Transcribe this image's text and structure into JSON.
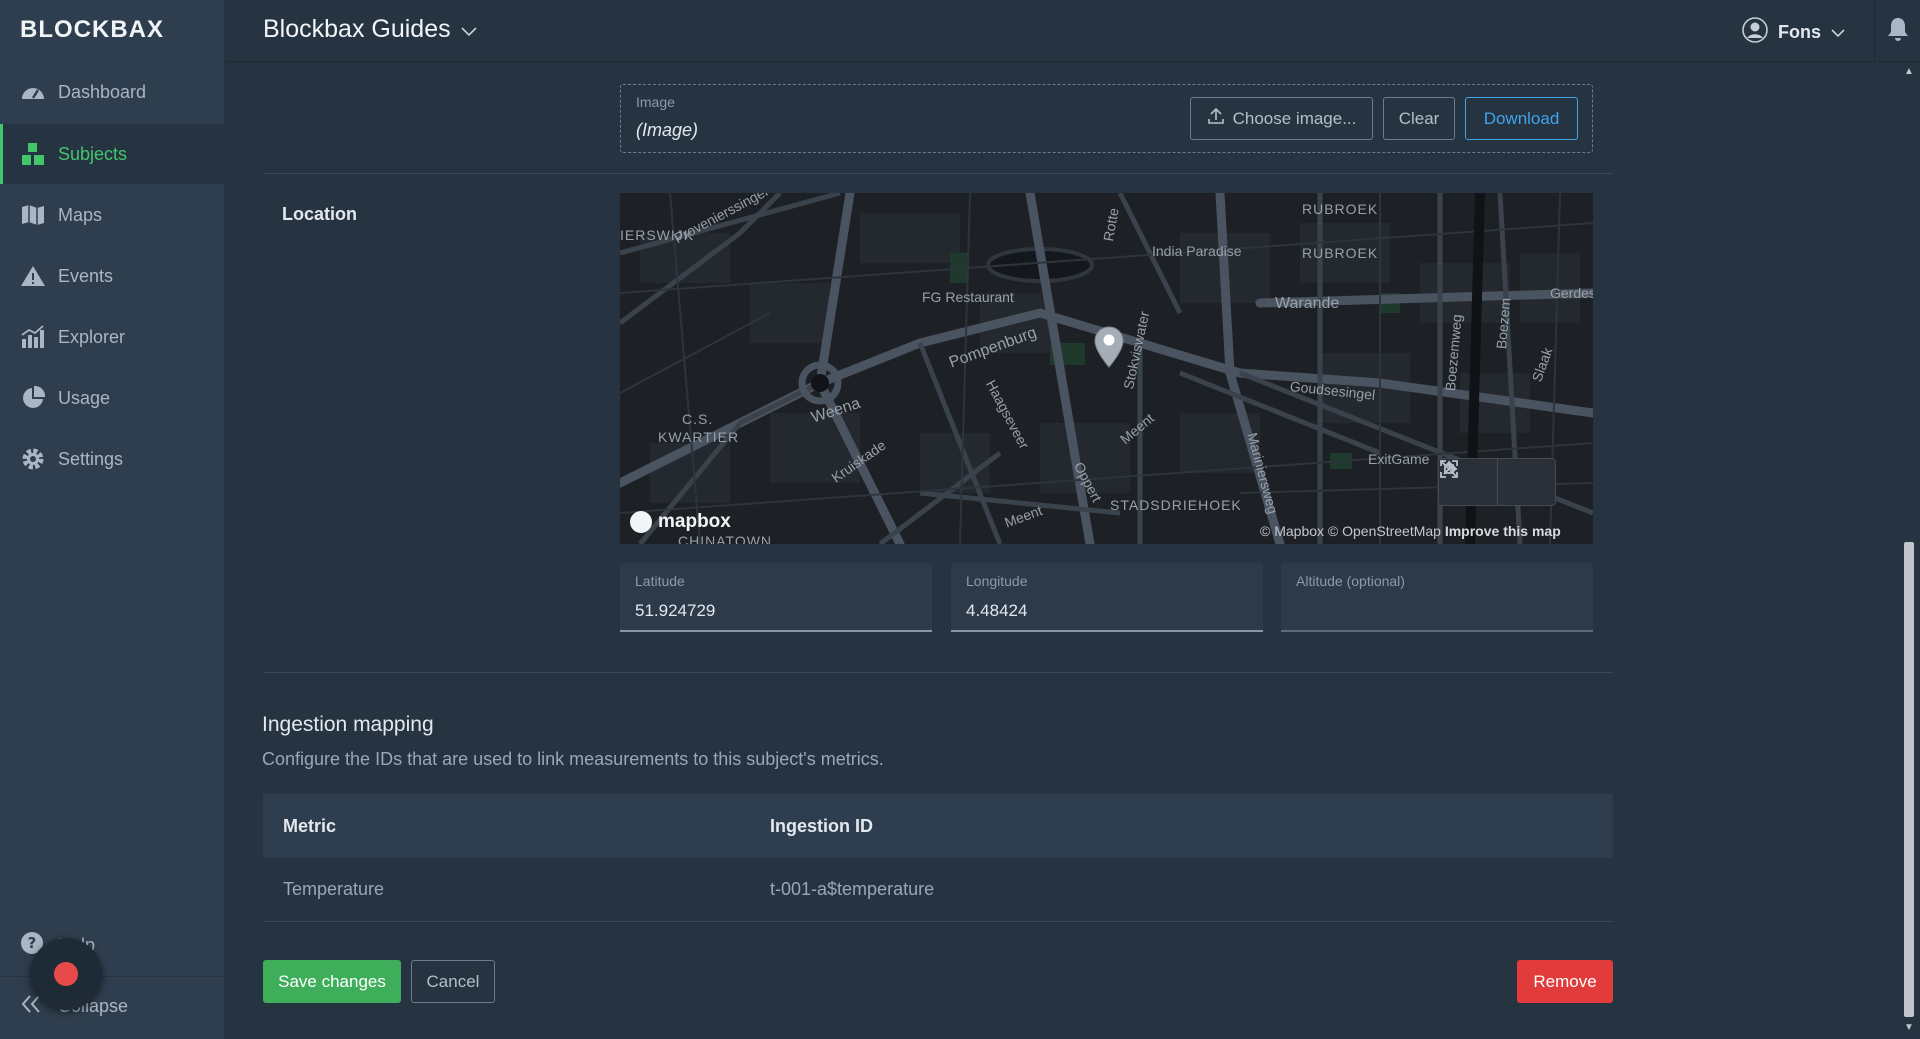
{
  "sidebar": {
    "logo": "BLOCKBAX",
    "items": [
      {
        "label": "Dashboard",
        "icon": "gauge-icon"
      },
      {
        "label": "Subjects",
        "icon": "blocks-icon"
      },
      {
        "label": "Maps",
        "icon": "map-icon"
      },
      {
        "label": "Events",
        "icon": "warning-icon"
      },
      {
        "label": "Explorer",
        "icon": "bar-chart-icon"
      },
      {
        "label": "Usage",
        "icon": "pie-chart-icon"
      },
      {
        "label": "Settings",
        "icon": "gear-icon"
      }
    ],
    "active_item": "Subjects",
    "help_label": "Help",
    "collapse_label": "Collapse"
  },
  "header": {
    "title": "Blockbax Guides",
    "user_name": "Fons"
  },
  "image_field": {
    "label": "Image",
    "value": "(Image)",
    "choose_label": "Choose image...",
    "clear_label": "Clear",
    "download_label": "Download"
  },
  "location": {
    "label": "Location",
    "map": {
      "labels": [
        "RUBROEK",
        "RUBROEK",
        "IERSWIJK",
        "Provenierssingel",
        "India Paradise",
        "Rotte",
        "FG Restaurant",
        "Warande",
        "Gerdes",
        "Pompenburg",
        "Stokviswater",
        "Boezemweg",
        "Boezem",
        "Slaak",
        "Goudsesingel",
        "C.S.",
        "KWARTIER",
        "Weena",
        "Haagseveer",
        "Meent",
        "Kruiskade",
        "Mariniersweg",
        "ExitGame",
        "Oppert",
        "STADSDRIEHOEK",
        "Meent",
        "CHINATOWN"
      ],
      "logo_text": "mapbox",
      "attribution": "© Mapbox © OpenStreetMap",
      "improve_link": "Improve this map"
    },
    "latitude": {
      "label": "Latitude",
      "value": "51.924729"
    },
    "longitude": {
      "label": "Longitude",
      "value": "4.48424"
    },
    "altitude": {
      "label": "Altitude (optional)",
      "value": ""
    }
  },
  "ingestion": {
    "title": "Ingestion mapping",
    "description": "Configure the IDs that are used to link measurements to this subject's metrics.",
    "columns": [
      "Metric",
      "Ingestion ID"
    ],
    "rows": [
      {
        "metric": "Temperature",
        "ingestion_id": "t-001-a$temperature"
      }
    ]
  },
  "actions": {
    "save_label": "Save changes",
    "cancel_label": "Cancel",
    "remove_label": "Remove"
  },
  "colors": {
    "accent_green": "#3eae5b",
    "danger_red": "#e13b3b",
    "link_blue": "#3fa4e8",
    "background": "#263341"
  }
}
